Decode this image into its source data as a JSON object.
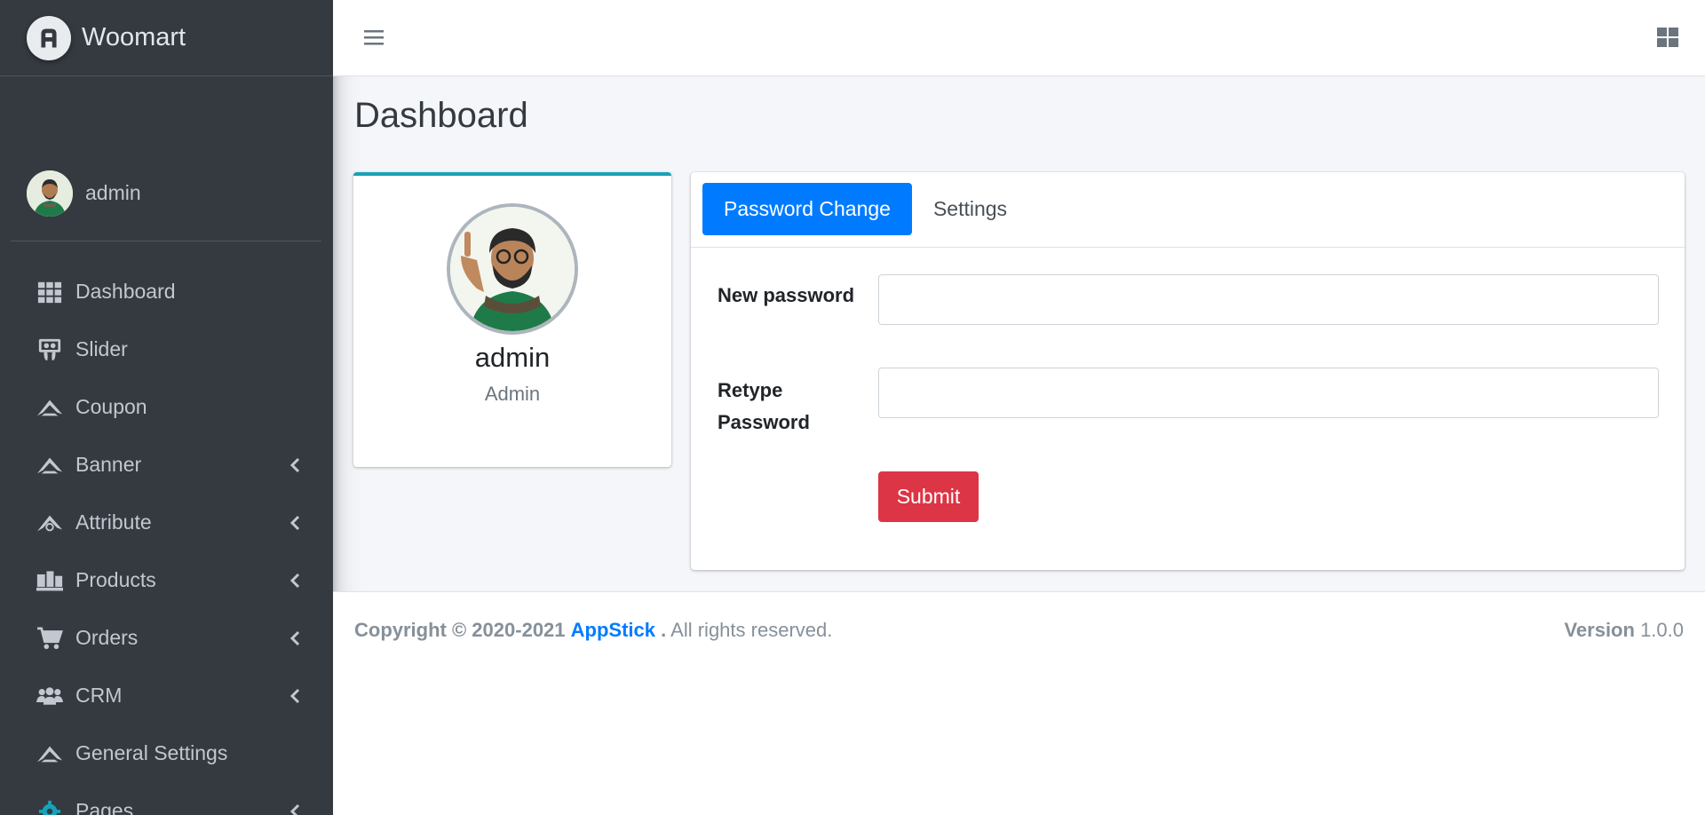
{
  "brand": {
    "name": "Woomart"
  },
  "user": {
    "name": "admin"
  },
  "sidebar": {
    "items": [
      {
        "label": "Dashboard",
        "icon": "grid-icon",
        "has_children": false
      },
      {
        "label": "Slider",
        "icon": "slideshare-icon",
        "has_children": false
      },
      {
        "label": "Coupon",
        "icon": "pied-piper-icon",
        "has_children": false
      },
      {
        "label": "Banner",
        "icon": "pied-piper-icon",
        "has_children": true
      },
      {
        "label": "Attribute",
        "icon": "pied-piper-alt-icon",
        "has_children": true
      },
      {
        "label": "Products",
        "icon": "pallet-icon",
        "has_children": true
      },
      {
        "label": "Orders",
        "icon": "cart-icon",
        "has_children": true
      },
      {
        "label": "CRM",
        "icon": "users-icon",
        "has_children": true
      },
      {
        "label": "General Settings",
        "icon": "pied-piper-icon",
        "has_children": false
      },
      {
        "label": "Pages",
        "icon": "gear-icon",
        "has_children": true
      }
    ]
  },
  "page": {
    "title": "Dashboard"
  },
  "profile": {
    "name": "admin",
    "role": "Admin"
  },
  "tabs": [
    {
      "label": "Password Change",
      "active": true
    },
    {
      "label": "Settings",
      "active": false
    }
  ],
  "form": {
    "new_password_label": "New password",
    "new_password_value": "",
    "retype_label_line1": "Retype",
    "retype_label_line2": "Password",
    "retype_value": "",
    "submit_label": "Submit"
  },
  "footer": {
    "copyright": "Copyright © 2020-2021",
    "company": "AppStick",
    "dot": ".",
    "rights": "All rights reserved.",
    "version_label": "Version",
    "version_value": "1.0.0"
  },
  "colors": {
    "sidebar_bg": "#343a40",
    "primary": "#007bff",
    "danger": "#dc3545",
    "card_accent": "#17a2b8"
  }
}
